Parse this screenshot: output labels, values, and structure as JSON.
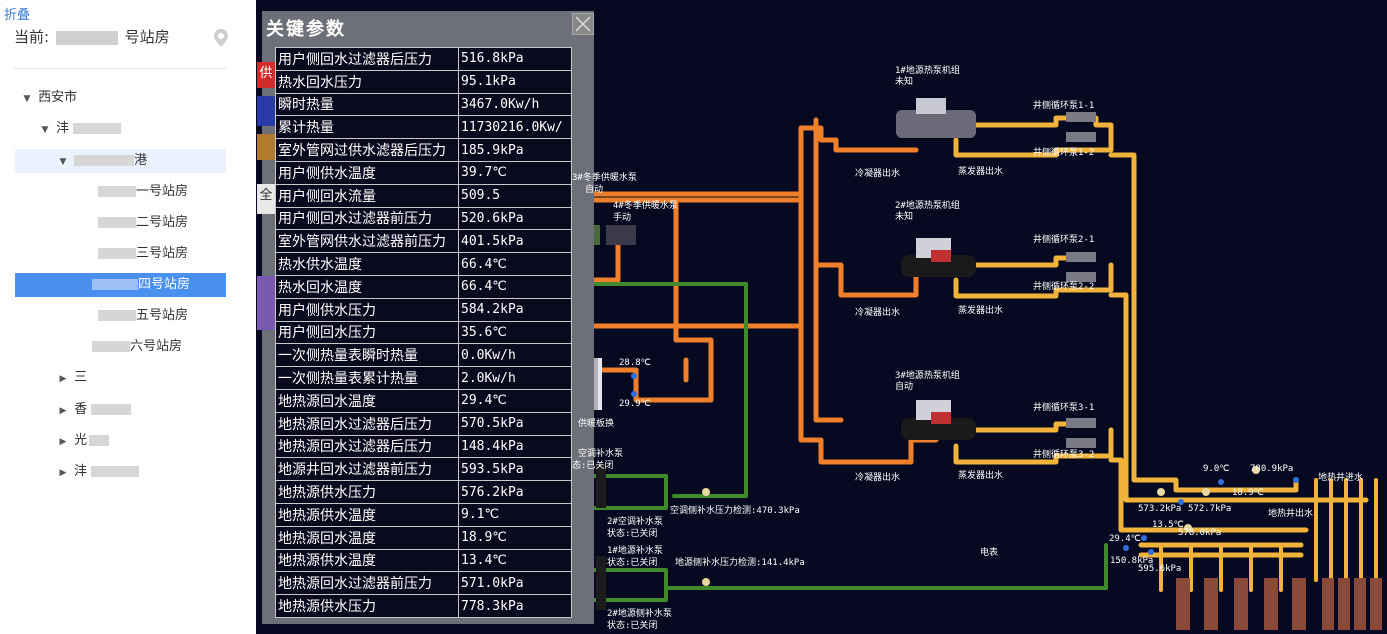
{
  "left": {
    "fold_label": "折叠",
    "current_prefix": "当前:",
    "current_suffix": "号站房",
    "tree": [
      {
        "label": "西安市",
        "expanded": true
      },
      {
        "label": "沣",
        "expanded": true
      },
      {
        "label": "港",
        "expanded": true
      },
      {
        "label": "一号站房"
      },
      {
        "label": "二号站房"
      },
      {
        "label": "三号站房"
      },
      {
        "label": "四号站房",
        "selected": true
      },
      {
        "label": "五号站房"
      },
      {
        "label": "六号站房"
      },
      {
        "label": "三"
      },
      {
        "label": "香"
      },
      {
        "label": "光"
      },
      {
        "label": "沣"
      }
    ]
  },
  "tabs": [
    "供",
    "全"
  ],
  "popup": {
    "title": "关键参数",
    "rows": [
      {
        "k": "用户侧回水过滤器后压力",
        "v": "516.8kPa"
      },
      {
        "k": "热水回水压力",
        "v": "95.1kPa"
      },
      {
        "k": "瞬时热量",
        "v": "3467.0Kw/h"
      },
      {
        "k": "累计热量",
        "v": "11730216.0Kw/"
      },
      {
        "k": "室外管网过供水滤器后压力",
        "v": "185.9kPa"
      },
      {
        "k": "用户侧供水温度",
        "v": "39.7℃"
      },
      {
        "k": "用户侧回水流量",
        "v": "509.5"
      },
      {
        "k": "用户侧回水过滤器前压力",
        "v": "520.6kPa"
      },
      {
        "k": "室外管网供水过滤器前压力",
        "v": "401.5kPa"
      },
      {
        "k": "热水供水温度",
        "v": "66.4℃"
      },
      {
        "k": "热水回水温度",
        "v": "66.4℃"
      },
      {
        "k": "用户侧供水压力",
        "v": "584.2kPa"
      },
      {
        "k": "用户侧回水压力",
        "v": "35.6℃"
      },
      {
        "k": "一次侧热量表瞬时热量",
        "v": "0.0Kw/h"
      },
      {
        "k": "一次侧热量表累计热量",
        "v": "2.0Kw/h"
      },
      {
        "k": "地热源回水温度",
        "v": "29.4℃"
      },
      {
        "k": "地热源回水过滤器后压力",
        "v": "570.5kPa"
      },
      {
        "k": "地热源回水过滤器后压力",
        "v": "148.4kPa"
      },
      {
        "k": "地源井回水过滤器前压力",
        "v": "593.5kPa"
      },
      {
        "k": "地热源供水压力",
        "v": "576.2kPa"
      },
      {
        "k": "地热源供水温度",
        "v": "9.1℃"
      },
      {
        "k": "地热源回水温度",
        "v": "18.9℃"
      },
      {
        "k": "地热源供水温度",
        "v": "13.4℃"
      },
      {
        "k": "地热源回水过滤器前压力",
        "v": "571.0kPa"
      },
      {
        "k": "地热源供水压力",
        "v": "778.3kPa"
      }
    ]
  },
  "diagram": {
    "pump3_name": "3#冬季供暖水泵",
    "pump3_state": "自动",
    "pump4_name": "4#冬季供暖水泵",
    "pump4_state": "手动",
    "hx_label": "供暖板换",
    "hx_t1": "28.8℃",
    "hx_t2": "29.9℃",
    "unit1_name": "1#地源热泵机组",
    "unit1_state": "未知",
    "unit2_name": "2#地源热泵机组",
    "unit2_state": "未知",
    "unit3_name": "3#地源热泵机组",
    "unit3_state": "自动",
    "cond_out": "冷凝器出水",
    "evap_out": "蒸发器出水",
    "well_pump_1_1": "井侧循环泵1-1",
    "well_pump_1_2": "井侧循环泵1-2",
    "well_pump_2_1": "井侧循环泵2-1",
    "well_pump_2_2": "井侧循环泵2-2",
    "well_pump_3_1": "井侧循环泵3-1",
    "well_pump_3_2": "井侧循环泵3-2",
    "ac_pump_name": "空调补水泵",
    "ac_pump_state": "态:已关闭",
    "ac_pump2_name": "2#空调补水泵",
    "ac_pump2_state": "状态:已关闭",
    "ac_pressure": "空调侧补水压力检测:470.3kPa",
    "gs_pump1_name": "1#地源补水泵",
    "gs_pump1_state": "状态:已关闭",
    "gs_pump2_name": "2#地源侧补水泵",
    "gs_pump2_state": "状态:已关闭",
    "gs_pressure": "地源侧补水压力检测:141.4kPa",
    "meter_label": "电表",
    "well_in_label": "地热井进水",
    "well_out_label": "地热井出水",
    "r_t1": "9.0℃",
    "r_p1": "780.9kPa",
    "r_p2": "573.2kPa",
    "r_p3": "572.7kPa",
    "r_t2": "18.9℃",
    "r_t3": "13.5℃",
    "r_p4": "578.0kPa",
    "r_t4": "29.4℃",
    "r_p5": "150.8kPa",
    "r_p6": "595.6kPa"
  },
  "colors": {
    "orange": "#f07f2a",
    "yellow": "#f2b33b",
    "green": "#3f8a2a",
    "bg": "#06091f"
  }
}
